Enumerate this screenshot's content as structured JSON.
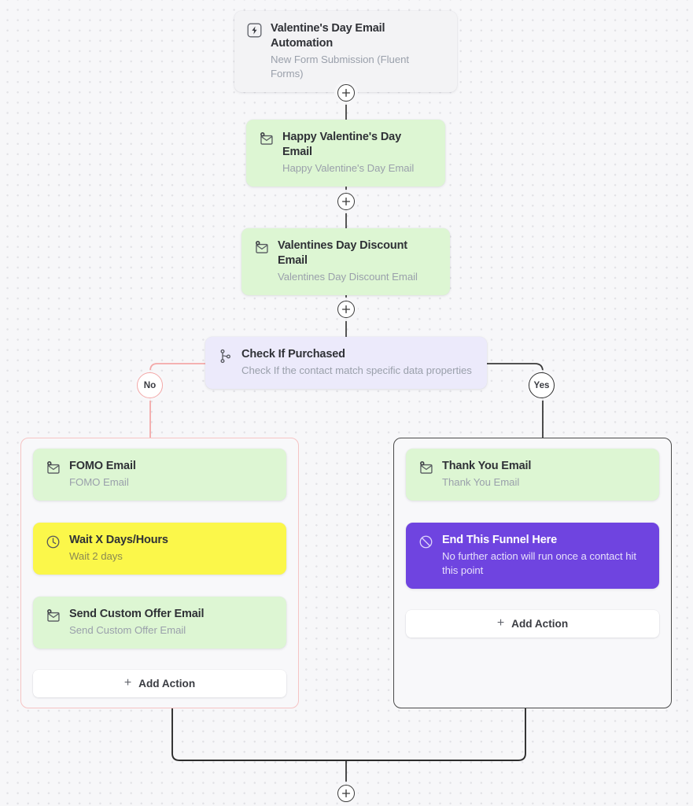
{
  "canvas": {
    "background_color": "#f7f7f9",
    "dot_color": "#e2e2e6"
  },
  "flow": {
    "trigger": {
      "icon": "lightning-bolt-icon",
      "title": "Valentine's Day Email Automation",
      "subtitle": "New Form Submission (Fluent Forms)",
      "color": "#f3f3f5"
    },
    "steps": [
      {
        "id": "happy-valentines-email",
        "icon": "send-email-icon",
        "title": "Happy Valentine's Day Email",
        "subtitle": "Happy Valentine's Day Email",
        "color": "#ddf6d3"
      },
      {
        "id": "valentines-discount-email",
        "icon": "send-email-icon",
        "title": "Valentines Day Discount Email",
        "subtitle": "Valentines Day Discount Email",
        "color": "#ddf6d3"
      }
    ],
    "condition": {
      "id": "check-if-purchased",
      "icon": "branch-icon",
      "title": "Check If Purchased",
      "subtitle": "Check If the contact match specific data properties",
      "color": "#eceafb"
    },
    "branches": {
      "no": {
        "label": "No",
        "border_color": "#f6c4c4",
        "steps": [
          {
            "id": "fomo-email",
            "icon": "send-email-icon",
            "title": "FOMO Email",
            "subtitle": "FOMO Email",
            "color": "#ddf6d3"
          },
          {
            "id": "wait-x-days-hours",
            "icon": "clock-icon",
            "title": "Wait X Days/Hours",
            "subtitle": "Wait 2 days",
            "color": "#fbf74a"
          },
          {
            "id": "send-custom-offer-email",
            "icon": "send-email-icon",
            "title": "Send Custom Offer Email",
            "subtitle": "Send Custom Offer Email",
            "color": "#ddf6d3"
          }
        ],
        "add_action_label": "Add Action"
      },
      "yes": {
        "label": "Yes",
        "border_color": "#4a4a4a",
        "steps": [
          {
            "id": "thank-you-email",
            "icon": "send-email-icon",
            "title": "Thank You Email",
            "subtitle": "Thank You Email",
            "color": "#ddf6d3"
          },
          {
            "id": "end-this-funnel-here",
            "icon": "ban-icon",
            "title": "End This Funnel Here",
            "subtitle": "No further action will run once a contact hit this point",
            "color": "#6f44e0"
          }
        ],
        "add_action_label": "Add Action"
      }
    },
    "connectors": {
      "plus_label": "+"
    }
  }
}
